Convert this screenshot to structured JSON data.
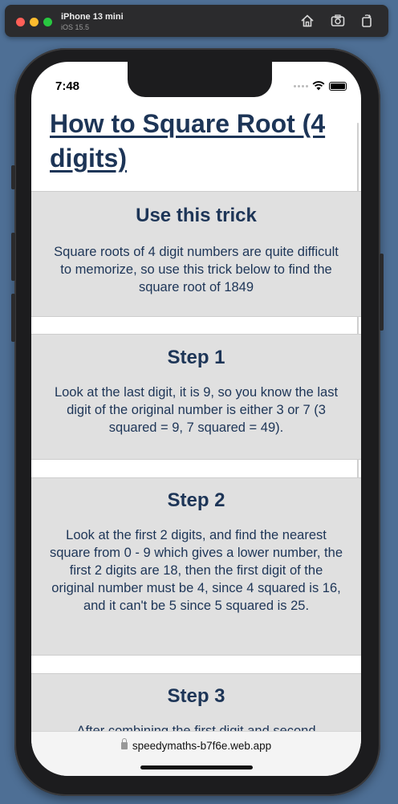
{
  "simulator": {
    "device_name": "iPhone 13 mini",
    "os_version": "iOS 15.5",
    "icons": [
      "home-icon",
      "screenshot-icon",
      "rotate-icon"
    ]
  },
  "status_bar": {
    "time": "7:48",
    "icons": [
      "cellular-dots-icon",
      "wifi-icon",
      "battery-icon"
    ]
  },
  "page": {
    "title": "How to Square Root (4 digits)",
    "cards": [
      {
        "heading": "Use this trick",
        "body": "Square roots of 4 digit numbers are quite difficult to memorize, so use this trick below to find the square root of 1849"
      },
      {
        "heading": "Step 1",
        "body": "Look at the last digit, it is 9, so you know the last digit of the original number is either 3 or 7 (3 squared = 9, 7 squared = 49)."
      },
      {
        "heading": "Step 2",
        "body": "Look at the first 2 digits, and find the nearest square from 0 - 9 which gives a lower number, the first 2 digits are 18, then the first digit of the original number must be 4, since 4 squared is 16, and it can't be 5 since 5 squared is 25."
      },
      {
        "heading": "Step 3",
        "body": "After combining the first digit and second"
      }
    ]
  },
  "browser": {
    "url": "speedymaths-b7f6e.web.app"
  },
  "colors": {
    "heading": "#1d3557",
    "card_bg": "#e0e0e0",
    "desktop_bg": "#4e6f95"
  }
}
